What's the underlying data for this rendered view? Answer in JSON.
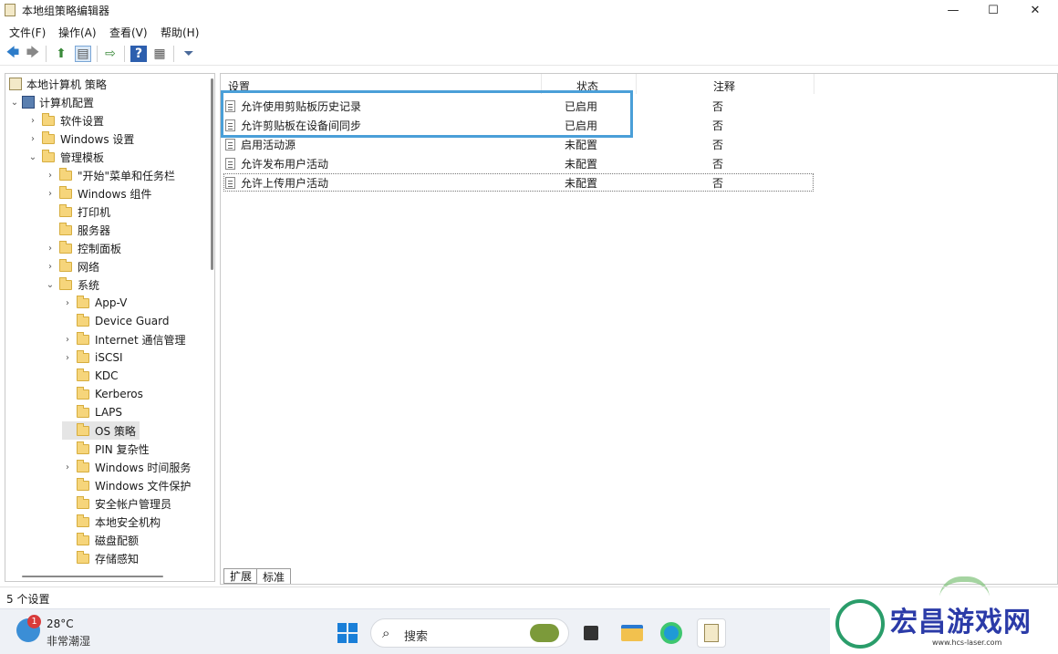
{
  "window": {
    "title": "本地组策略编辑器",
    "minimize": "—",
    "maximize": "☐",
    "close": "✕"
  },
  "menu": [
    "文件(F)",
    "操作(A)",
    "查看(V)",
    "帮助(H)"
  ],
  "tree": {
    "root": "本地计算机 策略",
    "computer_config": "计算机配置",
    "software": "软件设置",
    "windows_settings": "Windows 设置",
    "admin_templates": "管理模板",
    "start_menu": "\"开始\"菜单和任务栏",
    "windows_components": "Windows 组件",
    "printers": "打印机",
    "servers": "服务器",
    "control_panel": "控制面板",
    "network": "网络",
    "system": "系统",
    "system_children": [
      "App-V",
      "Device Guard",
      "Internet 通信管理",
      "iSCSI",
      "KDC",
      "Kerberos",
      "LAPS",
      "OS 策略",
      "PIN 复杂性",
      "Windows 时间服务",
      "Windows 文件保护",
      "安全帐户管理员",
      "本地安全机构",
      "磁盘配额",
      "存储感知"
    ]
  },
  "list": {
    "headers": {
      "setting": "设置",
      "state": "状态",
      "comment": "注释"
    },
    "rows": [
      {
        "name": "允许使用剪贴板历史记录",
        "state": "已启用",
        "comment": "否"
      },
      {
        "name": "允许剪贴板在设备间同步",
        "state": "已启用",
        "comment": "否"
      },
      {
        "name": "启用活动源",
        "state": "未配置",
        "comment": "否"
      },
      {
        "name": "允许发布用户活动",
        "state": "未配置",
        "comment": "否"
      },
      {
        "name": "允许上传用户活动",
        "state": "未配置",
        "comment": "否"
      }
    ]
  },
  "tabs": {
    "extended": "扩展",
    "standard": "标准"
  },
  "status": "5 个设置",
  "taskbar": {
    "badge": "1",
    "temperature": "28°C",
    "weather": "非常潮湿",
    "search": "搜索"
  },
  "watermark": {
    "text": "宏昌游戏网",
    "url": "www.hcs-laser.com"
  },
  "colors": {
    "highlight": "#4a9fd8",
    "folder": "#f6d57b",
    "taskbar": "#eef1f6"
  }
}
